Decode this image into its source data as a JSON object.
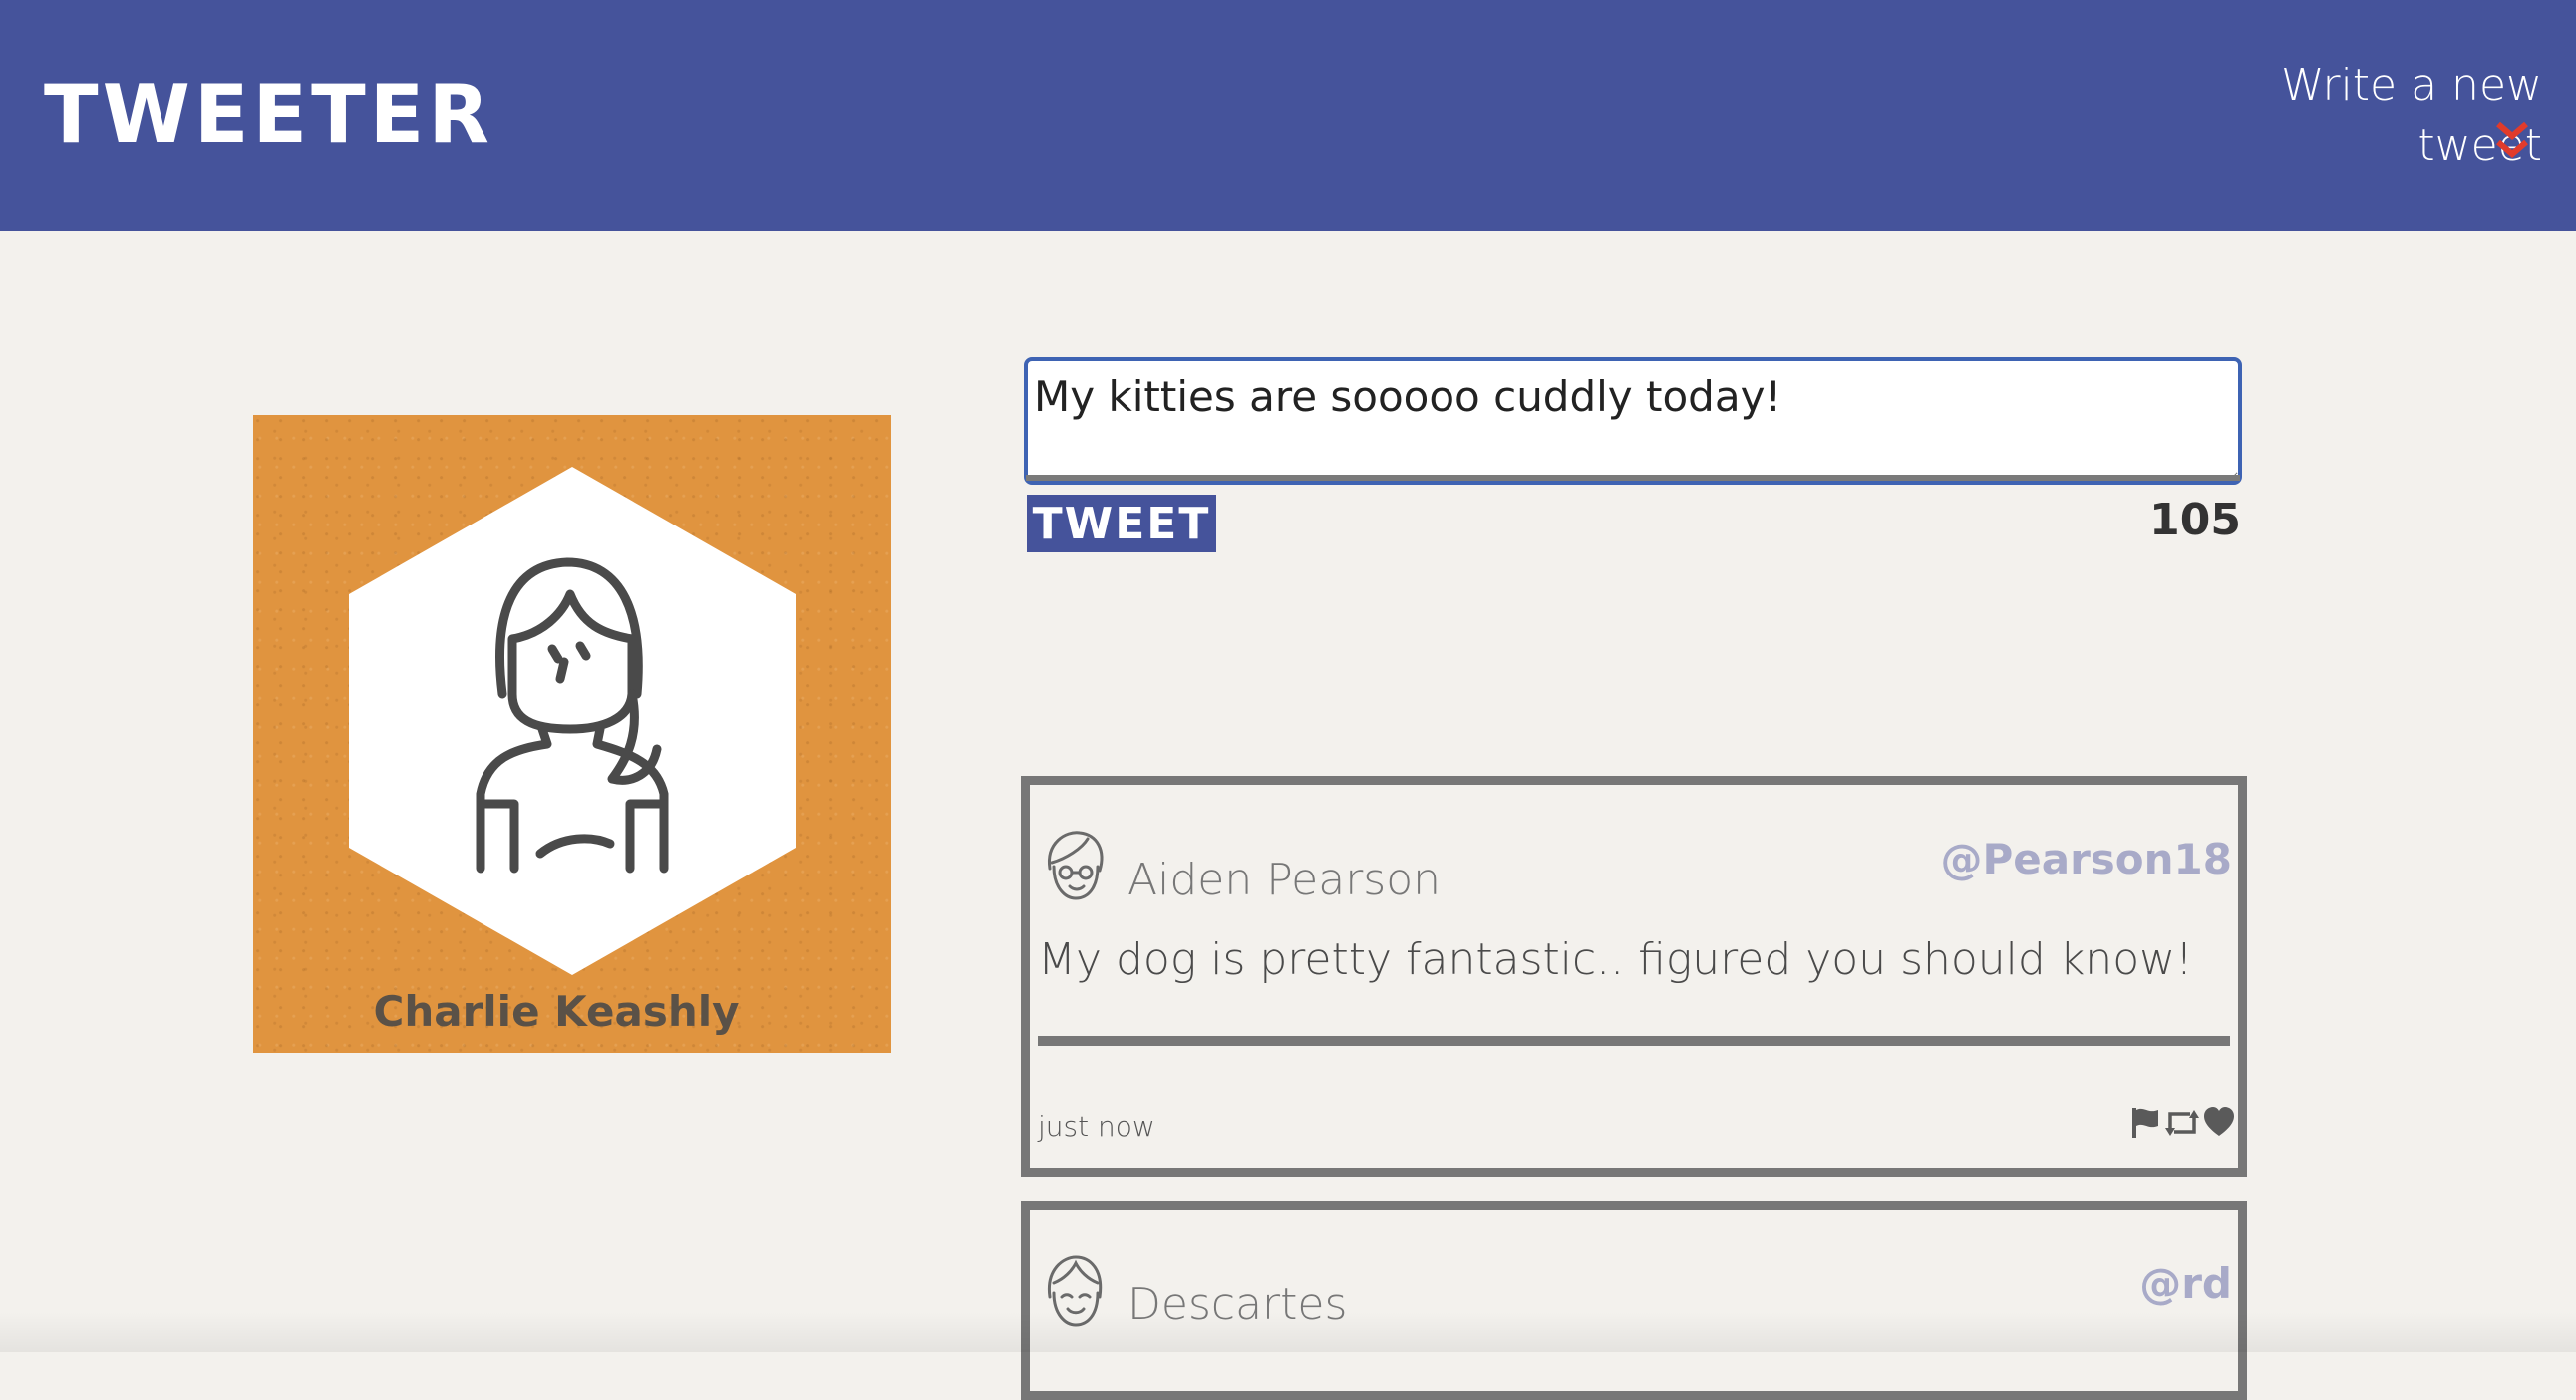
{
  "header": {
    "logo": "TWEETER",
    "compose_label": "Write a new tweet",
    "compose_icon": "double-chevron-down-icon",
    "accent_color": "#e13b2b",
    "background_color": "#45539b"
  },
  "profile": {
    "name": "Charlie Keashly",
    "avatar_icon": "woman-avatar-icon",
    "card_color": "#e0943f"
  },
  "composer": {
    "value": "My kitties are sooooo cuddly today!",
    "button_label": "TWEET",
    "counter": "105"
  },
  "tweets": [
    {
      "author": "Aiden Pearson",
      "handle": "@Pearson18",
      "body": "My dog is pretty fantastic.. figured you should know!",
      "timestamp": "just now",
      "avatar_icon": "man-with-glasses-avatar-icon",
      "actions": [
        "flag-icon",
        "retweet-icon",
        "heart-icon"
      ]
    },
    {
      "author": "Descartes",
      "handle": "@rd",
      "avatar_icon": "smiling-avatar-icon"
    }
  ]
}
